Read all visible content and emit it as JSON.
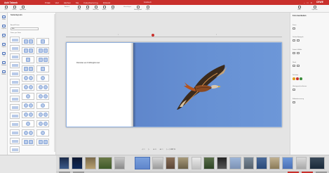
{
  "app": {
    "brand": "Ashi Tafamh",
    "menu": [
      "Prtlak",
      "Verl",
      "Hkchen",
      "Ma",
      "Fokochal tof ng",
      "Fitlinahr"
    ],
    "doc_title": "Fotobuch",
    "logo": "CEWE",
    "window_buttons": [
      "–",
      "□",
      "✕"
    ],
    "accent": "#c9302c"
  },
  "toolbar": {
    "buttons": [
      "Neu",
      "Öffnen",
      "Speichern",
      "Undo",
      "Redo",
      "Vorschau",
      "Seiten",
      "Text",
      "Hintergrund",
      "Clipart",
      "Rahmen",
      "Layout",
      "Masken"
    ],
    "right_buttons": [
      "Hilfe",
      "Optionen"
    ],
    "group_labels": [
      "Ändern",
      "Hinzufügen"
    ]
  },
  "left_rail": {
    "items": [
      "Fotos",
      "Layouts",
      "Hinter.",
      "Cliparts",
      "Text",
      "Rahmen",
      "Masken"
    ]
  },
  "layout_panel": {
    "title": "Seitenlayouts",
    "filter_label": "Anzahl Fotos",
    "filter_value": "Alle",
    "sub_label": "Fotos pro Seite"
  },
  "workspace": {
    "ruler_labels": [
      "1",
      "2"
    ],
    "left_page_caption": "Rotmilan am Frühlinghimmel",
    "zoom_controls": [
      "◁ □",
      "▷",
      "⊖ 1",
      "⊕ □",
      "▷ ◁ 100 %"
    ]
  },
  "right_panel": {
    "title": "Foto bearbeiten",
    "sections": [
      "Zoom",
      "Drehen/Spiegeln",
      "Farbe & Effekt",
      "Rand",
      "Schatten",
      "Hintergrund entfernen",
      "Bildverbesserung"
    ],
    "swatch_colors": [
      "#e0a020",
      "#c9302c",
      "#3c8d3c"
    ]
  },
  "photo": {
    "subject": "Red kite in flight",
    "sky_color": "#6690d3"
  },
  "filmstrip": {
    "tab_colors": [
      "#c9302c",
      "#9a9a9a"
    ]
  }
}
